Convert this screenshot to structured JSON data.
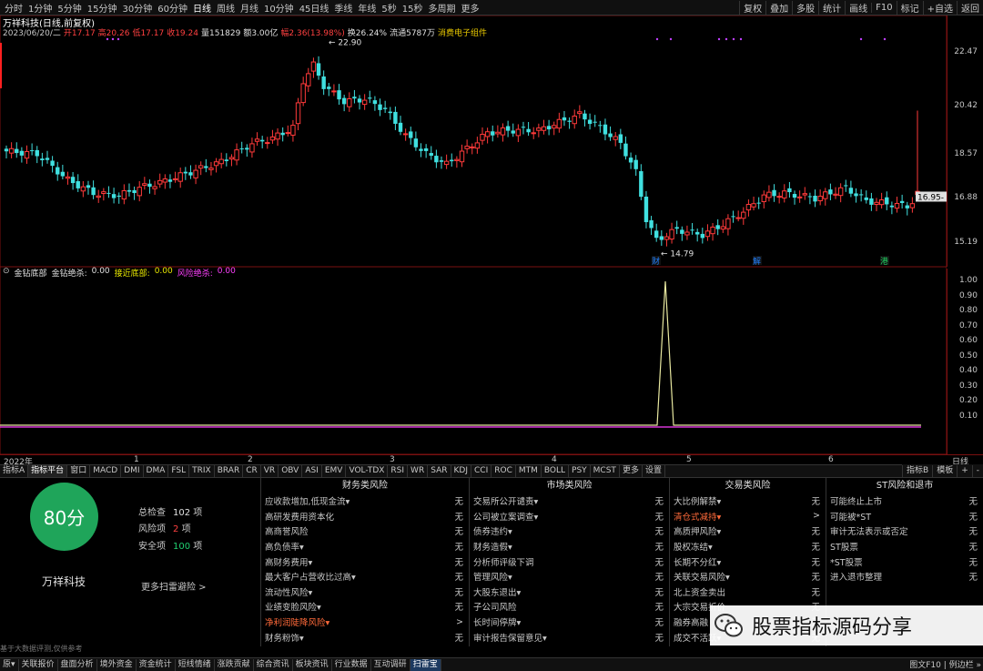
{
  "periods": [
    "分时",
    "1分钟",
    "5分钟",
    "15分钟",
    "30分钟",
    "60分钟",
    "日线",
    "周线",
    "月线",
    "10分钟",
    "45日线",
    "季线",
    "年线",
    "5秒",
    "15秒",
    "多周期",
    "更多"
  ],
  "active_period": "日线",
  "right_buttons": [
    "复权",
    "叠加",
    "多股",
    "统计",
    "画线",
    "F10",
    "标记",
    "+自选",
    "返回"
  ],
  "title": "万祥科技(日线,前复权)",
  "info": {
    "date": "2023/06/20/二",
    "open": "开17.17",
    "high": "高20.26",
    "low": "低17.17",
    "close": "收19.24",
    "volume": "量151829",
    "amount": "额3.00亿",
    "change": "幅2.36(13.98%)",
    "turnover": "换26.24%",
    "float": "流通5787万",
    "sector": "消费电子组件"
  },
  "price_axis": [
    "22.47",
    "20.42",
    "18.57",
    "16.88",
    "15.19"
  ],
  "price_marks": {
    "high_label": "22.90",
    "low_label": "14.79",
    "last_label": "16.95"
  },
  "event_marks": [
    "财",
    "解",
    "港"
  ],
  "indicator": {
    "name": "金钻底部",
    "fields": [
      {
        "label": "金钻绝杀:",
        "value": "0.00",
        "color": "#e0e0e0"
      },
      {
        "label": "接近底部:",
        "value": "0.00",
        "color": "#e8e800"
      },
      {
        "label": "风险绝杀:",
        "value": "0.00",
        "color": "#ff40ff"
      }
    ],
    "axis": [
      "1.00",
      "0.90",
      "0.80",
      "0.70",
      "0.60",
      "0.50",
      "0.40",
      "0.30",
      "0.20",
      "0.10"
    ]
  },
  "time_axis": [
    "2022年",
    "1",
    "2",
    "3",
    "4",
    "5",
    "6"
  ],
  "time_axis_right": "日线",
  "indicator_tabs": [
    "指标A",
    "指标平台",
    "窗口",
    "MACD",
    "DMI",
    "DMA",
    "FSL",
    "TRIX",
    "BRAR",
    "CR",
    "VR",
    "OBV",
    "ASI",
    "EMV",
    "VOL-TDX",
    "RSI",
    "WR",
    "SAR",
    "KDJ",
    "CCI",
    "ROC",
    "MTM",
    "BOLL",
    "PSY",
    "MCST",
    "更多",
    "设置"
  ],
  "active_indicator_tab": "指标平台",
  "indicator_tabs_right": [
    "指标B",
    "模板",
    "+",
    "-"
  ],
  "score": {
    "value": "80分",
    "stock": "万祥科技",
    "total_label": "总检查",
    "total": "102",
    "unit": "项",
    "risk_label": "风险项",
    "risk": "2",
    "safe_label": "安全项",
    "safe": "100",
    "more": "更多扫雷避险 >",
    "note": "基于大数据评测,仅供参考"
  },
  "risk_columns": [
    {
      "title": "财务类风险",
      "rows": [
        {
          "label": "应收款增加,低现金流▾",
          "value": "无"
        },
        {
          "label": "高研发费用资本化",
          "value": "无"
        },
        {
          "label": "高商誉风险",
          "value": "无"
        },
        {
          "label": "高负债率▾",
          "value": "无"
        },
        {
          "label": "高财务费用▾",
          "value": "无"
        },
        {
          "label": "最大客户占营收比过高▾",
          "value": "无"
        },
        {
          "label": "流动性风险▾",
          "value": "无"
        },
        {
          "label": "业绩变脸风险▾",
          "value": "无"
        },
        {
          "label": "净利润陡降风险▾",
          "value": ">",
          "highlight": true
        },
        {
          "label": "财务粉饰▾",
          "value": "无"
        }
      ]
    },
    {
      "title": "市场类风险",
      "rows": [
        {
          "label": "交易所公开谴责▾",
          "value": "无"
        },
        {
          "label": "公司被立案调查▾",
          "value": "无"
        },
        {
          "label": "债券违约▾",
          "value": "无"
        },
        {
          "label": "财务造假▾",
          "value": "无"
        },
        {
          "label": "分析师评级下调",
          "value": "无"
        },
        {
          "label": "管理风险▾",
          "value": "无"
        },
        {
          "label": "大股东退出▾",
          "value": "无"
        },
        {
          "label": "子公司风险",
          "value": "无"
        },
        {
          "label": "长时间停牌▾",
          "value": "无"
        },
        {
          "label": "审计报告保留意见▾",
          "value": "无"
        }
      ]
    },
    {
      "title": "交易类风险",
      "rows": [
        {
          "label": "大比例解禁▾",
          "value": "无"
        },
        {
          "label": "清仓式减持▾",
          "value": ">",
          "highlight": true
        },
        {
          "label": "高质押风险▾",
          "value": "无"
        },
        {
          "label": "股权冻结▾",
          "value": "无"
        },
        {
          "label": "长期不分红▾",
          "value": "无"
        },
        {
          "label": "关联交易风险▾",
          "value": "无"
        },
        {
          "label": "北上资金卖出",
          "value": "无"
        },
        {
          "label": "大宗交易折价",
          "value": "无"
        },
        {
          "label": "融券高融",
          "value": "无"
        },
        {
          "label": "成交不活跃▾",
          "value": "无"
        }
      ]
    },
    {
      "title": "ST风险和退市",
      "rows": [
        {
          "label": "可能终止上市",
          "value": "无"
        },
        {
          "label": "可能被*ST",
          "value": "无"
        },
        {
          "label": "审计无法表示或否定",
          "value": "无"
        },
        {
          "label": "ST股票",
          "value": "无"
        },
        {
          "label": "*ST股票",
          "value": "无"
        },
        {
          "label": "进入退市整理",
          "value": "无"
        }
      ]
    }
  ],
  "watermark": "股票指标源码分享",
  "bottom_tabs": [
    "原▾",
    "关联报价",
    "盘面分析",
    "境外资金",
    "资金统计",
    "短线情绪",
    "涨跌贡献",
    "综合资讯",
    "板块资讯",
    "行业数据",
    "互动调研",
    "扫雷宝"
  ],
  "active_bottom_tab": "扫雷宝",
  "bottom_right": "图文F10 | 例边栏 »",
  "colors": {
    "up": "#ff3a3a",
    "down": "#40e0e0",
    "score_green": "#1fa55a",
    "highlight": "#ff6a3a",
    "indicator_line": "#e8e8a0",
    "risk_line": "#ff40ff"
  }
}
